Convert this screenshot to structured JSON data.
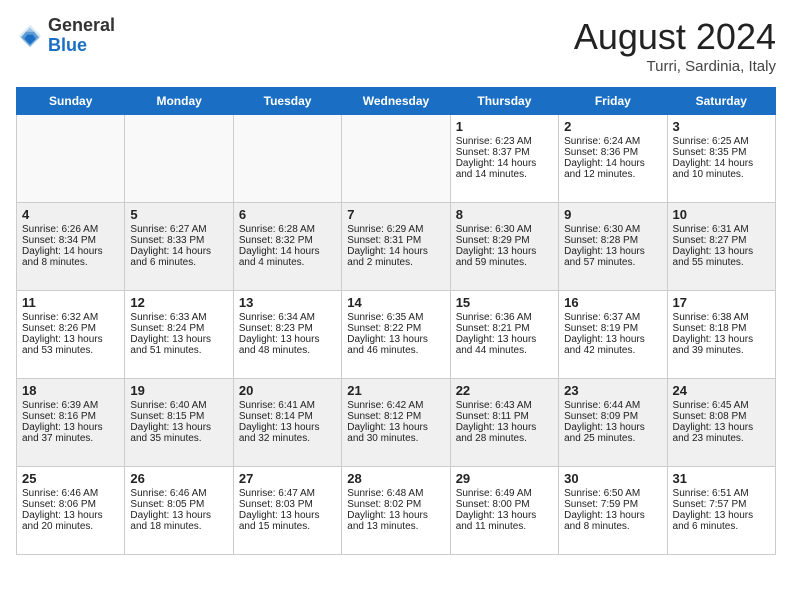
{
  "header": {
    "logo_general": "General",
    "logo_blue": "Blue",
    "title": "August 2024",
    "subtitle": "Turri, Sardinia, Italy"
  },
  "days_of_week": [
    "Sunday",
    "Monday",
    "Tuesday",
    "Wednesday",
    "Thursday",
    "Friday",
    "Saturday"
  ],
  "weeks": [
    [
      {
        "day": "",
        "content": ""
      },
      {
        "day": "",
        "content": ""
      },
      {
        "day": "",
        "content": ""
      },
      {
        "day": "",
        "content": ""
      },
      {
        "day": "1",
        "content": "Sunrise: 6:23 AM\nSunset: 8:37 PM\nDaylight: 14 hours and 14 minutes."
      },
      {
        "day": "2",
        "content": "Sunrise: 6:24 AM\nSunset: 8:36 PM\nDaylight: 14 hours and 12 minutes."
      },
      {
        "day": "3",
        "content": "Sunrise: 6:25 AM\nSunset: 8:35 PM\nDaylight: 14 hours and 10 minutes."
      }
    ],
    [
      {
        "day": "4",
        "content": "Sunrise: 6:26 AM\nSunset: 8:34 PM\nDaylight: 14 hours and 8 minutes."
      },
      {
        "day": "5",
        "content": "Sunrise: 6:27 AM\nSunset: 8:33 PM\nDaylight: 14 hours and 6 minutes."
      },
      {
        "day": "6",
        "content": "Sunrise: 6:28 AM\nSunset: 8:32 PM\nDaylight: 14 hours and 4 minutes."
      },
      {
        "day": "7",
        "content": "Sunrise: 6:29 AM\nSunset: 8:31 PM\nDaylight: 14 hours and 2 minutes."
      },
      {
        "day": "8",
        "content": "Sunrise: 6:30 AM\nSunset: 8:29 PM\nDaylight: 13 hours and 59 minutes."
      },
      {
        "day": "9",
        "content": "Sunrise: 6:30 AM\nSunset: 8:28 PM\nDaylight: 13 hours and 57 minutes."
      },
      {
        "day": "10",
        "content": "Sunrise: 6:31 AM\nSunset: 8:27 PM\nDaylight: 13 hours and 55 minutes."
      }
    ],
    [
      {
        "day": "11",
        "content": "Sunrise: 6:32 AM\nSunset: 8:26 PM\nDaylight: 13 hours and 53 minutes."
      },
      {
        "day": "12",
        "content": "Sunrise: 6:33 AM\nSunset: 8:24 PM\nDaylight: 13 hours and 51 minutes."
      },
      {
        "day": "13",
        "content": "Sunrise: 6:34 AM\nSunset: 8:23 PM\nDaylight: 13 hours and 48 minutes."
      },
      {
        "day": "14",
        "content": "Sunrise: 6:35 AM\nSunset: 8:22 PM\nDaylight: 13 hours and 46 minutes."
      },
      {
        "day": "15",
        "content": "Sunrise: 6:36 AM\nSunset: 8:21 PM\nDaylight: 13 hours and 44 minutes."
      },
      {
        "day": "16",
        "content": "Sunrise: 6:37 AM\nSunset: 8:19 PM\nDaylight: 13 hours and 42 minutes."
      },
      {
        "day": "17",
        "content": "Sunrise: 6:38 AM\nSunset: 8:18 PM\nDaylight: 13 hours and 39 minutes."
      }
    ],
    [
      {
        "day": "18",
        "content": "Sunrise: 6:39 AM\nSunset: 8:16 PM\nDaylight: 13 hours and 37 minutes."
      },
      {
        "day": "19",
        "content": "Sunrise: 6:40 AM\nSunset: 8:15 PM\nDaylight: 13 hours and 35 minutes."
      },
      {
        "day": "20",
        "content": "Sunrise: 6:41 AM\nSunset: 8:14 PM\nDaylight: 13 hours and 32 minutes."
      },
      {
        "day": "21",
        "content": "Sunrise: 6:42 AM\nSunset: 8:12 PM\nDaylight: 13 hours and 30 minutes."
      },
      {
        "day": "22",
        "content": "Sunrise: 6:43 AM\nSunset: 8:11 PM\nDaylight: 13 hours and 28 minutes."
      },
      {
        "day": "23",
        "content": "Sunrise: 6:44 AM\nSunset: 8:09 PM\nDaylight: 13 hours and 25 minutes."
      },
      {
        "day": "24",
        "content": "Sunrise: 6:45 AM\nSunset: 8:08 PM\nDaylight: 13 hours and 23 minutes."
      }
    ],
    [
      {
        "day": "25",
        "content": "Sunrise: 6:46 AM\nSunset: 8:06 PM\nDaylight: 13 hours and 20 minutes."
      },
      {
        "day": "26",
        "content": "Sunrise: 6:46 AM\nSunset: 8:05 PM\nDaylight: 13 hours and 18 minutes."
      },
      {
        "day": "27",
        "content": "Sunrise: 6:47 AM\nSunset: 8:03 PM\nDaylight: 13 hours and 15 minutes."
      },
      {
        "day": "28",
        "content": "Sunrise: 6:48 AM\nSunset: 8:02 PM\nDaylight: 13 hours and 13 minutes."
      },
      {
        "day": "29",
        "content": "Sunrise: 6:49 AM\nSunset: 8:00 PM\nDaylight: 13 hours and 11 minutes."
      },
      {
        "day": "30",
        "content": "Sunrise: 6:50 AM\nSunset: 7:59 PM\nDaylight: 13 hours and 8 minutes."
      },
      {
        "day": "31",
        "content": "Sunrise: 6:51 AM\nSunset: 7:57 PM\nDaylight: 13 hours and 6 minutes."
      }
    ]
  ]
}
